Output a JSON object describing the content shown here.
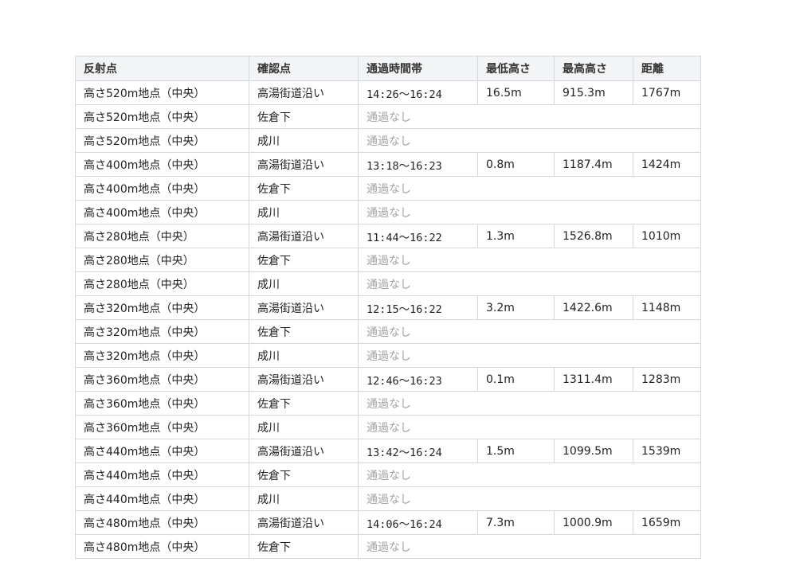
{
  "table": {
    "headers": [
      "反射点",
      "確認点",
      "通過時間帯",
      "最低高さ",
      "最高高さ",
      "距離"
    ],
    "rows": [
      {
        "point": "高さ520m地点（中央）",
        "check": "高湯街道沿い",
        "time": "14:26〜16:24",
        "min": "16.5m",
        "max": "915.3m",
        "dist": "1767m"
      },
      {
        "point": "高さ520m地点（中央）",
        "check": "佐倉下",
        "none": "通過なし"
      },
      {
        "point": "高さ520m地点（中央）",
        "check": "成川",
        "none": "通過なし"
      },
      {
        "point": "高さ400m地点（中央）",
        "check": "高湯街道沿い",
        "time": "13:18〜16:23",
        "min": "0.8m",
        "max": "1187.4m",
        "dist": "1424m"
      },
      {
        "point": "高さ400m地点（中央）",
        "check": "佐倉下",
        "none": "通過なし"
      },
      {
        "point": "高さ400m地点（中央）",
        "check": "成川",
        "none": "通過なし"
      },
      {
        "point": "高さ280地点（中央）",
        "check": "高湯街道沿い",
        "time": "11:44〜16:22",
        "min": "1.3m",
        "max": "1526.8m",
        "dist": "1010m"
      },
      {
        "point": "高さ280地点（中央）",
        "check": "佐倉下",
        "none": "通過なし"
      },
      {
        "point": "高さ280地点（中央）",
        "check": "成川",
        "none": "通過なし"
      },
      {
        "point": "高さ320m地点（中央）",
        "check": "高湯街道沿い",
        "time": "12:15〜16:22",
        "min": "3.2m",
        "max": "1422.6m",
        "dist": "1148m"
      },
      {
        "point": "高さ320m地点（中央）",
        "check": "佐倉下",
        "none": "通過なし"
      },
      {
        "point": "高さ320m地点（中央）",
        "check": "成川",
        "none": "通過なし"
      },
      {
        "point": "高さ360m地点（中央）",
        "check": "高湯街道沿い",
        "time": "12:46〜16:23",
        "min": "0.1m",
        "max": "1311.4m",
        "dist": "1283m"
      },
      {
        "point": "高さ360m地点（中央）",
        "check": "佐倉下",
        "none": "通過なし"
      },
      {
        "point": "高さ360m地点（中央）",
        "check": "成川",
        "none": "通過なし"
      },
      {
        "point": "高さ440m地点（中央）",
        "check": "高湯街道沿い",
        "time": "13:42〜16:24",
        "min": "1.5m",
        "max": "1099.5m",
        "dist": "1539m"
      },
      {
        "point": "高さ440m地点（中央）",
        "check": "佐倉下",
        "none": "通過なし"
      },
      {
        "point": "高さ440m地点（中央）",
        "check": "成川",
        "none": "通過なし"
      },
      {
        "point": "高さ480m地点（中央）",
        "check": "高湯街道沿い",
        "time": "14:06〜16:24",
        "min": "7.3m",
        "max": "1000.9m",
        "dist": "1659m"
      },
      {
        "point": "高さ480m地点（中央）",
        "check": "佐倉下",
        "none": "通過なし"
      }
    ]
  }
}
